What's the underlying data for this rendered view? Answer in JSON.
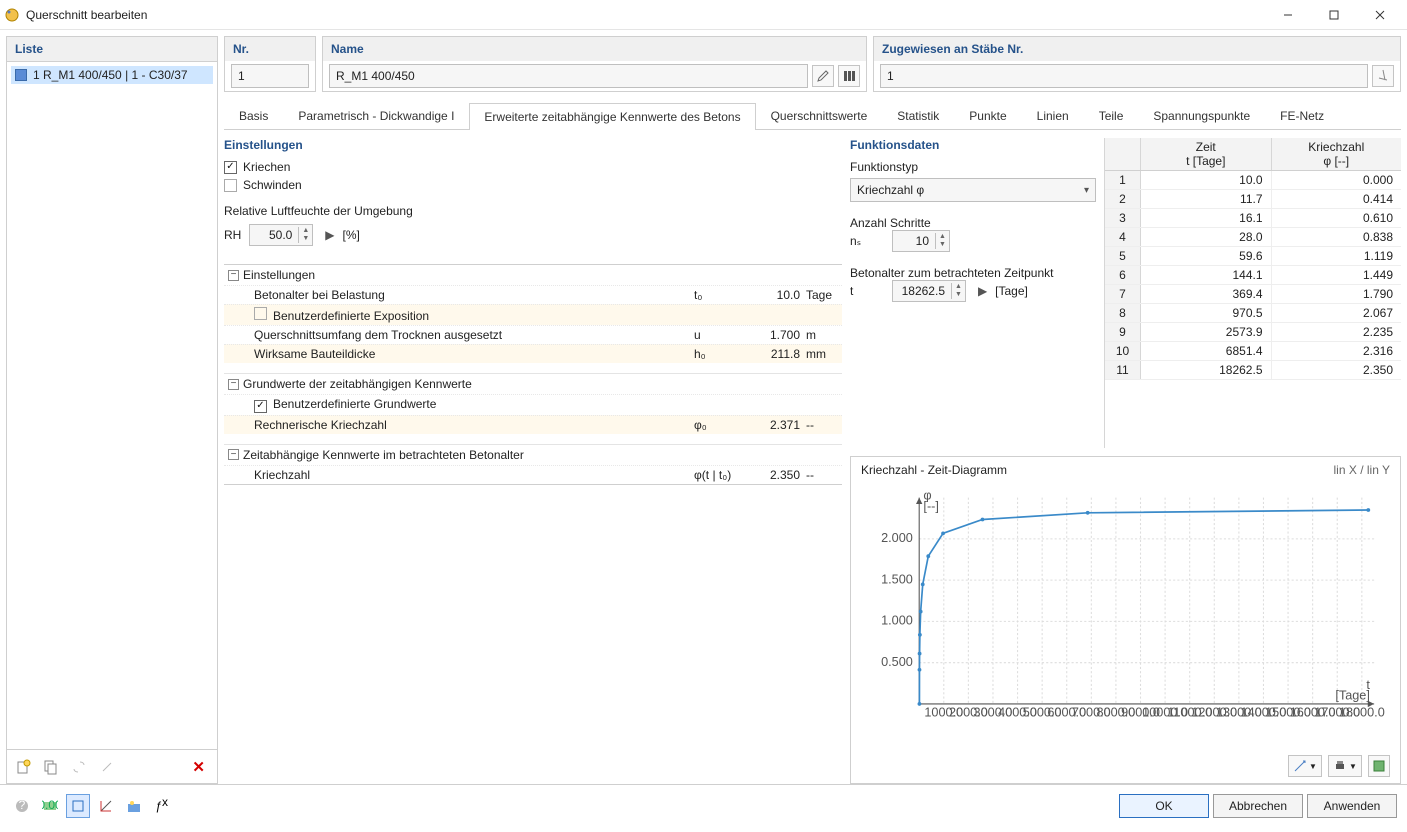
{
  "window": {
    "title": "Querschnitt bearbeiten"
  },
  "list": {
    "header": "Liste",
    "item": "1   R_M1 400/450 | 1 - C30/37"
  },
  "header": {
    "nr_label": "Nr.",
    "nr_value": "1",
    "name_label": "Name",
    "name_value": "R_M1 400/450",
    "assign_label": "Zugewiesen an Stäbe Nr.",
    "assign_value": "1"
  },
  "tabs": [
    "Basis",
    "Parametrisch - Dickwandige I",
    "Erweiterte zeitabhängige Kennwerte des Betons",
    "Querschnittswerte",
    "Statistik",
    "Punkte",
    "Linien",
    "Teile",
    "Spannungspunkte",
    "FE-Netz"
  ],
  "active_tab": 2,
  "settings": {
    "title": "Einstellungen",
    "kriechen": "Kriechen",
    "kriechen_on": true,
    "schwinden": "Schwinden",
    "schwinden_on": false,
    "rh_label": "Relative Luftfeuchte der Umgebung",
    "rh_sym": "RH",
    "rh_val": "50.0",
    "rh_unit": "[%]"
  },
  "tree": {
    "cat1": "Einstellungen",
    "r1": {
      "label": "Betonalter bei Belastung",
      "sym": "t₀",
      "val": "10.0",
      "unit": "Tage"
    },
    "r2": {
      "label": "Benutzerdefinierte Exposition",
      "cb": false
    },
    "r3": {
      "label": "Querschnittsumfang dem Trocknen ausgesetzt",
      "sym": "u",
      "val": "1.700",
      "unit": "m"
    },
    "r4": {
      "label": "Wirksame Bauteildicke",
      "sym": "h₀",
      "val": "211.8",
      "unit": "mm"
    },
    "cat2": "Grundwerte der zeitabhängigen Kennwerte",
    "r5": {
      "label": "Benutzerdefinierte Grundwerte",
      "cb": true
    },
    "r6": {
      "label": "Rechnerische Kriechzahl",
      "sym": "φ₀",
      "val": "2.371",
      "unit": "--"
    },
    "cat3": "Zeitabhängige Kennwerte im betrachteten Betonalter",
    "r7": {
      "label": "Kriechzahl",
      "sym": "φ(t | t₀)",
      "val": "2.350",
      "unit": "--"
    }
  },
  "func": {
    "title": "Funktionsdaten",
    "type_label": "Funktionstyp",
    "type_value": "Kriechzahl φ",
    "steps_label": "Anzahl Schritte",
    "steps_sym": "nₛ",
    "steps_val": "10",
    "age_label": "Betonalter zum betrachteten Zeitpunkt",
    "age_sym": "t",
    "age_val": "18262.5",
    "age_unit": "[Tage]"
  },
  "table": {
    "head_t": "Zeit",
    "head_t2": "t [Tage]",
    "head_k": "Kriechzahl",
    "head_k2": "φ [--]",
    "rows": [
      {
        "i": "1",
        "t": "10.0",
        "k": "0.000"
      },
      {
        "i": "2",
        "t": "11.7",
        "k": "0.414"
      },
      {
        "i": "3",
        "t": "16.1",
        "k": "0.610"
      },
      {
        "i": "4",
        "t": "28.0",
        "k": "0.838"
      },
      {
        "i": "5",
        "t": "59.6",
        "k": "1.119"
      },
      {
        "i": "6",
        "t": "144.1",
        "k": "1.449"
      },
      {
        "i": "7",
        "t": "369.4",
        "k": "1.790"
      },
      {
        "i": "8",
        "t": "970.5",
        "k": "2.067"
      },
      {
        "i": "9",
        "t": "2573.9",
        "k": "2.235"
      },
      {
        "i": "10",
        "t": "6851.4",
        "k": "2.316"
      },
      {
        "i": "11",
        "t": "18262.5",
        "k": "2.350"
      }
    ]
  },
  "chart": {
    "title": "Kriechzahl - Zeit-Diagramm",
    "scale": "lin X / lin Y",
    "ylab": "φ",
    "yunit": "[--]",
    "xlab": "t",
    "xunit": "[Tage]"
  },
  "chart_data": {
    "type": "line",
    "x": [
      10.0,
      11.7,
      16.1,
      28.0,
      59.6,
      144.1,
      369.4,
      970.5,
      2573.9,
      6851.4,
      18262.5
    ],
    "y": [
      0.0,
      0.414,
      0.61,
      0.838,
      1.119,
      1.449,
      1.79,
      2.067,
      2.235,
      2.316,
      2.35
    ],
    "xlabel": "t [Tage]",
    "ylabel": "φ [--]",
    "xlim": [
      0,
      18500
    ],
    "ylim": [
      0,
      2.5
    ],
    "yticks": [
      0.5,
      1.0,
      1.5,
      2.0
    ],
    "xticks": [
      1000,
      2000,
      3000,
      4000,
      5000,
      6000,
      7000,
      8000,
      9000,
      10000,
      11000,
      12000,
      13000,
      14000,
      15000,
      16000,
      17000,
      18000
    ],
    "xticklabels": [
      "1000.0",
      "2000.0",
      "3000.0",
      "4000.0",
      "5000.0",
      "6000.0",
      "7000.0",
      "8000.0",
      "9000.0",
      "10000.0",
      "11000.0",
      "12000.0",
      "13000.0",
      "14000.0",
      "15000.0",
      "16000.0",
      "17000.0",
      "18000.0"
    ]
  },
  "buttons": {
    "ok": "OK",
    "cancel": "Abbrechen",
    "apply": "Anwenden"
  }
}
